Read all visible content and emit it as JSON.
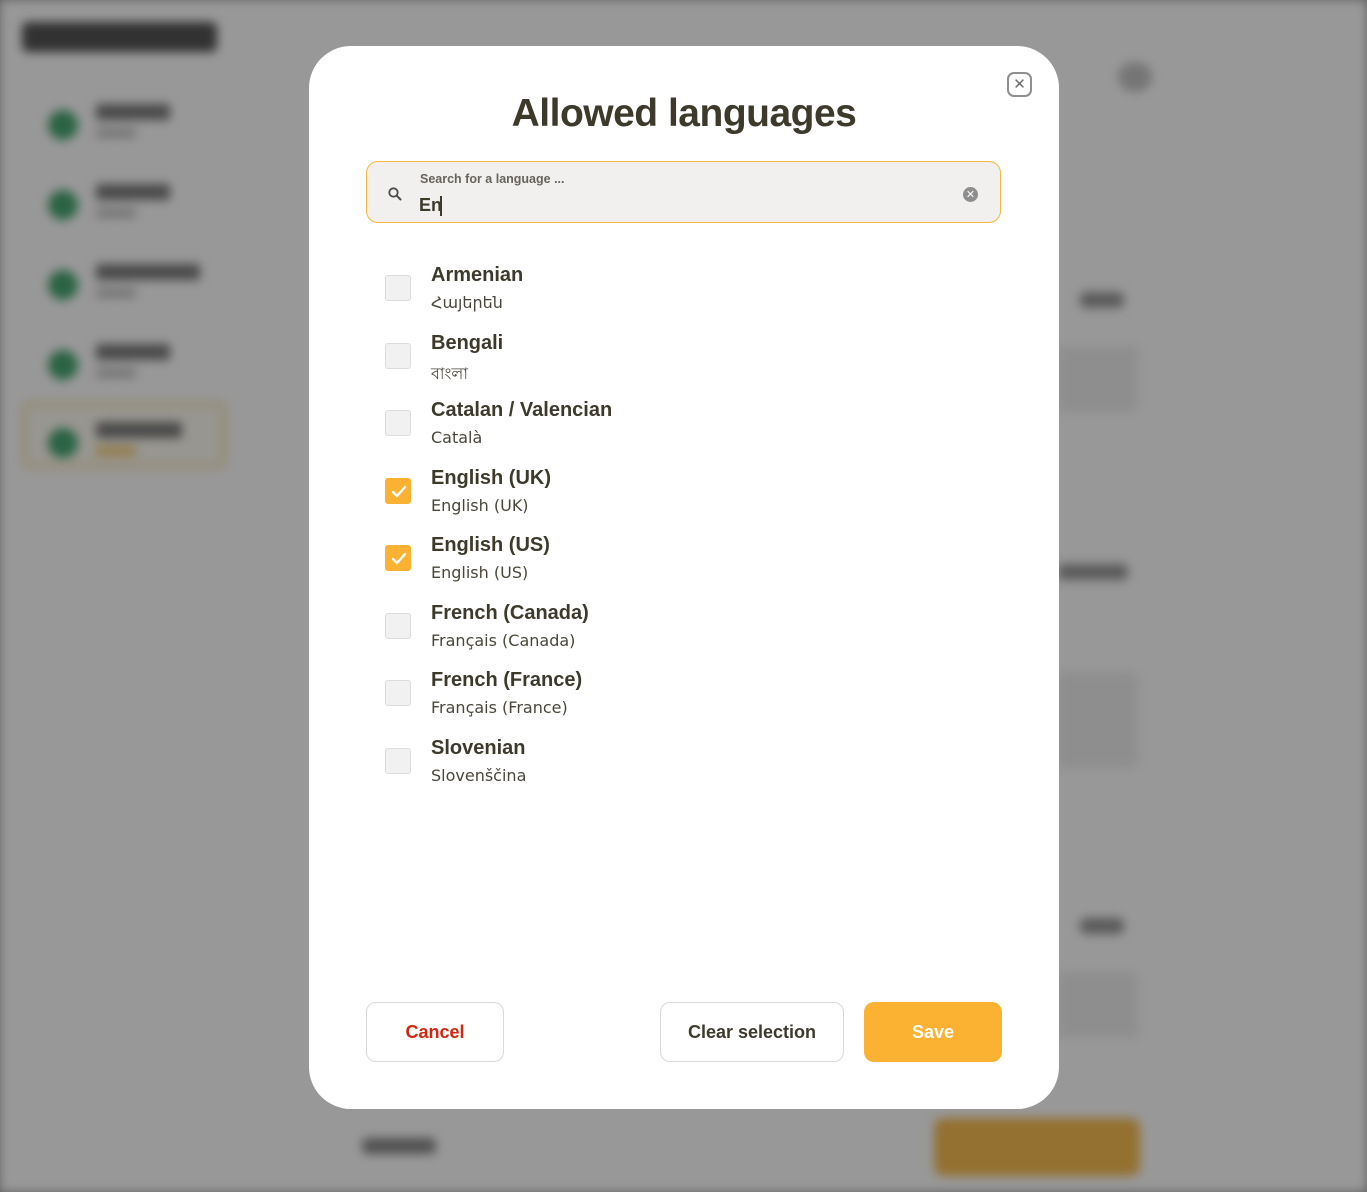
{
  "modal": {
    "title": "Allowed languages",
    "close_icon": "close-icon"
  },
  "search": {
    "label": "Search for a language ...",
    "value": "En",
    "icon": "search-icon",
    "clear_icon": "clear-icon"
  },
  "languages": [
    {
      "name": "Armenian",
      "native": "Հայերեն",
      "checked": false
    },
    {
      "name": "Bengali",
      "native": "বাংলা",
      "checked": false
    },
    {
      "name": "Catalan / Valencian",
      "native": "Català",
      "checked": false
    },
    {
      "name": "English (UK)",
      "native": "English (UK)",
      "checked": true
    },
    {
      "name": "English (US)",
      "native": "English (US)",
      "checked": true
    },
    {
      "name": "French (Canada)",
      "native": "Français (Canada)",
      "checked": false
    },
    {
      "name": "French (France)",
      "native": "Français (France)",
      "checked": false
    },
    {
      "name": "Slovenian",
      "native": "Slovenščina",
      "checked": false
    }
  ],
  "footer": {
    "cancel_label": "Cancel",
    "clear_label": "Clear selection",
    "save_label": "Save"
  },
  "colors": {
    "accent": "#fbb232",
    "cancel_text": "#d4250f",
    "title_text": "#3d3a2c"
  }
}
